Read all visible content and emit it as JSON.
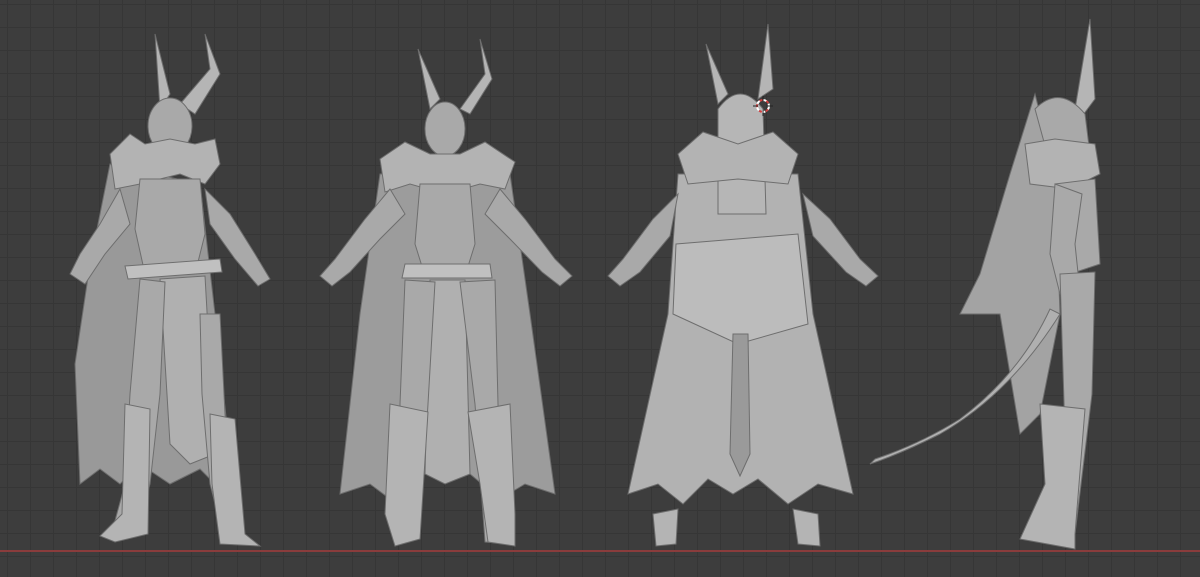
{
  "viewport": {
    "background": "#3d3d3d",
    "grid_line_color": "#363636",
    "floor_axis_color": "#8a3c3c"
  },
  "model": {
    "base_color": "#a9a9a9",
    "shade_color": "#8e8e8e",
    "highlight_color": "#c4c4c4",
    "outline_color": "#6e6e6e"
  },
  "views": [
    {
      "view": "three-quarter"
    },
    {
      "view": "front"
    },
    {
      "view": "back"
    },
    {
      "view": "side"
    }
  ],
  "cursor": {
    "icon": "3d-cursor-icon",
    "ring_color": "#d04040",
    "ring_inner": "#ffffff"
  }
}
